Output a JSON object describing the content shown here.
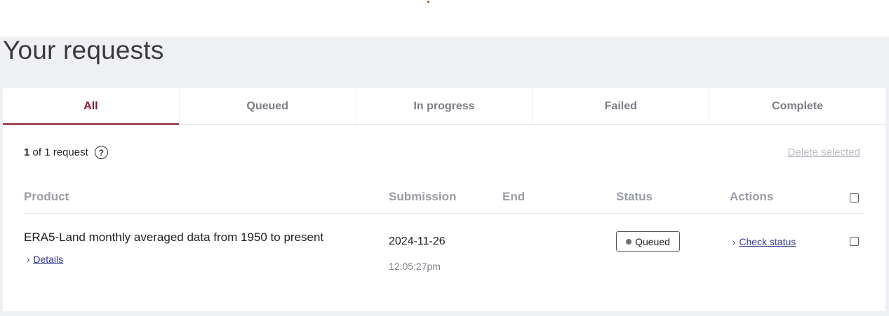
{
  "page": {
    "title": "Your requests"
  },
  "tabs": [
    {
      "label": "All"
    },
    {
      "label": "Queued"
    },
    {
      "label": "In progress"
    },
    {
      "label": "Failed"
    },
    {
      "label": "Complete"
    }
  ],
  "summary": {
    "count": "1",
    "text": "of 1 request",
    "help_icon": "?"
  },
  "actions": {
    "delete_selected": "Delete selected"
  },
  "table": {
    "headers": {
      "product": "Product",
      "submission": "Submission",
      "end": "End",
      "status": "Status",
      "actions": "Actions"
    },
    "rows": [
      {
        "product": "ERA5-Land monthly averaged data from 1950 to present",
        "details": "Details",
        "submission_date": "2024-11-26",
        "submission_time": "12:05:27pm",
        "end": "",
        "status": "Queued",
        "action": "Check status"
      }
    ]
  },
  "colors": {
    "accent": "#8c1b2e",
    "link": "#2f3a8f",
    "page_bg": "#eff0f4"
  }
}
